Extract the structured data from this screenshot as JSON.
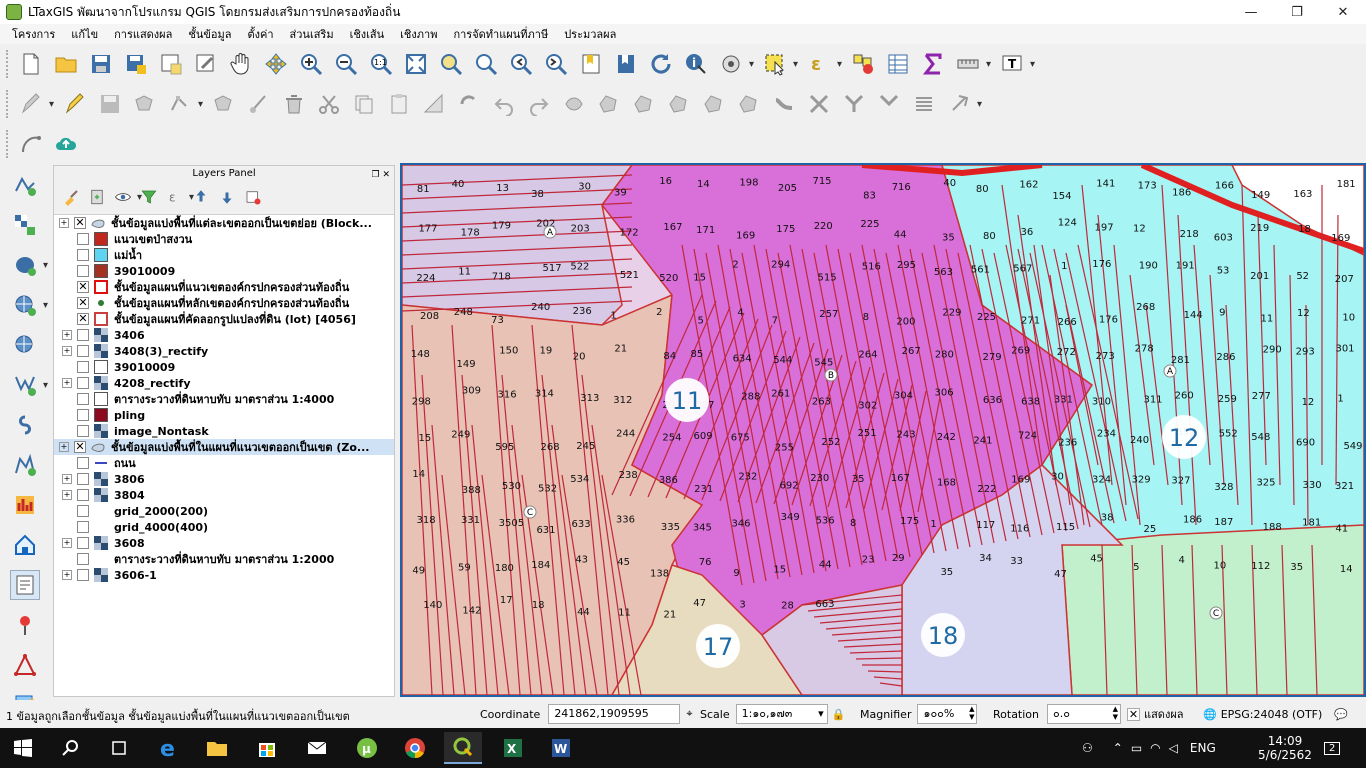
{
  "window": {
    "title": "LTaxGIS พัฒนาจากโปรแกรม QGIS โดยกรมส่งเสริมการปกครองท้องถิ่น",
    "minimize": "—",
    "maximize": "❐",
    "close": "✕"
  },
  "menu": [
    "โครงการ",
    "แก้ไข",
    "การแสดงผล",
    "ชั้นข้อมูล",
    "ตั้งค่า",
    "ส่วนเสริม",
    "เชิงเส้น",
    "เชิงภาพ",
    "การจัดทำแผนที่ภาษี",
    "ประมวลผล"
  ],
  "layers_panel": {
    "title": "Layers Panel",
    "layers": [
      {
        "label": "ชั้นข้อมูลแบ่งพื้นที่แต่ละเขตออกเป็นเขตย่อย (Block...",
        "checked": "✕",
        "expand": "+",
        "sym": "polygon",
        "color": "#c5d5e6",
        "indent": 0
      },
      {
        "label": "แนวเขตป่าสงวน",
        "checked": "",
        "expand": "",
        "sym": "fill",
        "color": "#c0281f",
        "indent": 1
      },
      {
        "label": "แม่น้ำ",
        "checked": "",
        "expand": "",
        "sym": "fill",
        "color": "#5fd4f0",
        "indent": 1
      },
      {
        "label": "39010009",
        "checked": "",
        "expand": "",
        "sym": "fill",
        "color": "#a23221",
        "indent": 1
      },
      {
        "label": "ชั้นข้อมูลแผนที่แนวเขตองค์กรปกครองส่วนท้องถิ่น",
        "checked": "✕",
        "expand": "",
        "sym": "outline",
        "color": "#e01010",
        "indent": 1
      },
      {
        "label": "ชั้นข้อมูลแผนที่หลักเขตองค์กรปกครองส่วนท้องถิ่น",
        "checked": "✕",
        "expand": "",
        "sym": "point",
        "color": "#2e7d32",
        "indent": 1
      },
      {
        "label": "ชั้นข้อมูลแผนที่คัดลอกรูปแปลงที่ดิน (lot) [4056]",
        "checked": "✕",
        "expand": "",
        "sym": "outline",
        "color": "#c84040",
        "indent": 1
      },
      {
        "label": "3406",
        "checked": "",
        "expand": "+",
        "sym": "raster",
        "color": "#3a5a80",
        "indent": 1
      },
      {
        "label": "3408(3)_rectify",
        "checked": "",
        "expand": "+",
        "sym": "raster",
        "color": "#3a5a80",
        "indent": 1
      },
      {
        "label": "39010009",
        "checked": "",
        "expand": "",
        "sym": "fill",
        "color": "#ffffff",
        "indent": 1
      },
      {
        "label": "4208_rectify",
        "checked": "",
        "expand": "+",
        "sym": "raster",
        "color": "#3a5a80",
        "indent": 1
      },
      {
        "label": "ตารางระวางที่ดินหาบทับ มาตราส่วน 1:4000",
        "checked": "",
        "expand": "",
        "sym": "fill",
        "color": "#ffffff",
        "indent": 1
      },
      {
        "label": "pling",
        "checked": "",
        "expand": "",
        "sym": "fill",
        "color": "#8b0a1e",
        "indent": 1
      },
      {
        "label": "image_Nontask",
        "checked": "",
        "expand": "",
        "sym": "raster",
        "color": "#3a5a80",
        "indent": 1
      },
      {
        "label": "ชั้นข้อมูลแบ่งพื้นที่ในแผนที่แนวเขตออกเป็นเขต (Zo...",
        "checked": "✕",
        "expand": "+",
        "sym": "polygon",
        "color": "#c5d5e6",
        "indent": 0,
        "selected": true
      },
      {
        "label": "ถนน",
        "checked": "",
        "expand": "",
        "sym": "line",
        "color": "#3a48c0",
        "indent": 1
      },
      {
        "label": "3806",
        "checked": "",
        "expand": "+",
        "sym": "raster",
        "color": "#3a5a80",
        "indent": 1
      },
      {
        "label": "3804",
        "checked": "",
        "expand": "+",
        "sym": "raster",
        "color": "#3a5a80",
        "indent": 1
      },
      {
        "label": "grid_2000(200)",
        "checked": "",
        "expand": "",
        "sym": "none",
        "color": "#ffffff",
        "indent": 1
      },
      {
        "label": "grid_4000(400)",
        "checked": "",
        "expand": "",
        "sym": "none",
        "color": "#ffffff",
        "indent": 1
      },
      {
        "label": "3608",
        "checked": "",
        "expand": "+",
        "sym": "raster",
        "color": "#3a5a80",
        "indent": 1
      },
      {
        "label": "ตารางระวางที่ดินหาบทับ มาตราส่วน 1:2000",
        "checked": "",
        "expand": "",
        "sym": "none",
        "color": "#ffffff",
        "indent": 1
      },
      {
        "label": "3606-1",
        "checked": "",
        "expand": "+",
        "sym": "raster",
        "color": "#3a5a80",
        "indent": 1
      }
    ]
  },
  "map": {
    "zones": [
      "11",
      "12",
      "17",
      "18"
    ],
    "blocks": [
      "A",
      "B",
      "C",
      "A",
      "C"
    ],
    "parcel_numbers": [
      "81",
      "40",
      "13",
      "38",
      "30",
      "39",
      "16",
      "14",
      "198",
      "205",
      "715",
      "83",
      "716",
      "40",
      "80",
      "162",
      "154",
      "141",
      "173",
      "186",
      "166",
      "149",
      "163",
      "181",
      "177",
      "178",
      "179",
      "202",
      "203",
      "172",
      "167",
      "171",
      "169",
      "175",
      "220",
      "225",
      "44",
      "35",
      "80",
      "36",
      "124",
      "197",
      "12",
      "218",
      "603",
      "219",
      "18",
      "169",
      "224",
      "11",
      "718",
      "517",
      "522",
      "521",
      "520",
      "15",
      "2",
      "294",
      "515",
      "516",
      "295",
      "563",
      "561",
      "567",
      "1",
      "176",
      "190",
      "191",
      "53",
      "201",
      "52",
      "207",
      "208",
      "248",
      "73",
      "240",
      "236",
      "1",
      "2",
      "5",
      "4",
      "7",
      "257",
      "8",
      "200",
      "229",
      "225",
      "271",
      "266",
      "176",
      "268",
      "144",
      "9",
      "11",
      "12",
      "10",
      "148",
      "149",
      "150",
      "19",
      "20",
      "21",
      "84",
      "85",
      "634",
      "544",
      "545",
      "264",
      "267",
      "280",
      "279",
      "269",
      "272",
      "273",
      "278",
      "281",
      "286",
      "290",
      "293",
      "301",
      "298",
      "309",
      "316",
      "314",
      "313",
      "312",
      "297",
      "287",
      "288",
      "261",
      "263",
      "302",
      "304",
      "306",
      "636",
      "638",
      "331",
      "310",
      "311",
      "260",
      "259",
      "277",
      "12",
      "1",
      "15",
      "249",
      "595",
      "268",
      "245",
      "244",
      "254",
      "609",
      "675",
      "255",
      "252",
      "251",
      "243",
      "242",
      "241",
      "724",
      "236",
      "234",
      "240",
      "551",
      "552",
      "548",
      "690",
      "549",
      "14",
      "388",
      "530",
      "532",
      "534",
      "238",
      "386",
      "231",
      "232",
      "692",
      "230",
      "35",
      "167",
      "168",
      "222",
      "169",
      "30",
      "324",
      "329",
      "327",
      "328",
      "325",
      "330",
      "321",
      "318",
      "331",
      "3505",
      "631",
      "633",
      "336",
      "335",
      "345",
      "346",
      "349",
      "536",
      "8",
      "175",
      "1",
      "117",
      "116",
      "115",
      "38",
      "25",
      "186",
      "187",
      "188",
      "181",
      "41",
      "49",
      "59",
      "180",
      "184",
      "43",
      "45",
      "138",
      "76",
      "9",
      "15",
      "44",
      "23",
      "29",
      "35",
      "34",
      "33",
      "47",
      "45",
      "5",
      "4",
      "10",
      "112",
      "35",
      "14",
      "140",
      "142",
      "17",
      "18",
      "44",
      "11",
      "21",
      "47",
      "3",
      "28",
      "663"
    ]
  },
  "status": {
    "message": "1 ข้อมูลถูกเลือกชั้นข้อมูล ชั้นข้อมูลแบ่งพื้นที่ในแผนที่แนวเขตออกเป็นเขต",
    "coordinate_label": "Coordinate",
    "coordinate_value": "241862,1909595",
    "scale_label": "Scale",
    "scale_value": "1:๑๐,๑๗๓",
    "magnifier_label": "Magnifier",
    "magnifier_value": "๑๐๐%",
    "rotation_label": "Rotation",
    "rotation_value": "๐.๐",
    "render_label": "แสดงผล",
    "render_checked": "✕",
    "crs": "EPSG:24048 (OTF)"
  },
  "taskbar": {
    "lang": "ENG",
    "time": "14:09",
    "date": "5/6/2562",
    "notif": "2"
  }
}
